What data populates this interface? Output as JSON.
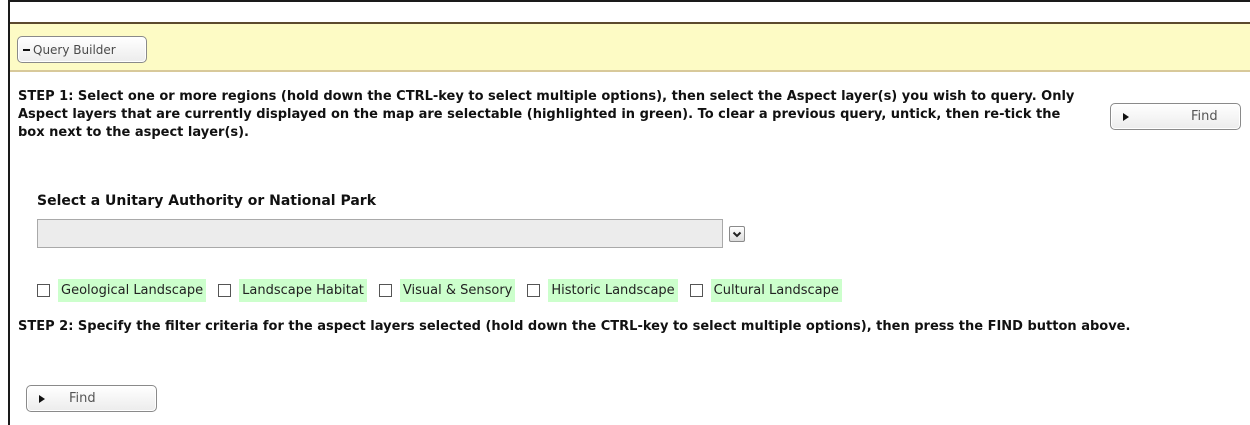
{
  "panel": {
    "toggle_symbol": "−",
    "title": "Query Builder"
  },
  "step1": {
    "text": "STEP 1: Select one or more regions (hold down the CTRL-key to select multiple options), then select the Aspect layer(s) you wish to query. Only Aspect layers that are currently displayed on the map are selectable (highlighted in green). To clear a previous query, untick, then re-tick the box next to the aspect layer(s)."
  },
  "find_button": {
    "label": "Find"
  },
  "region": {
    "label": "Select a Unitary Authority or National Park",
    "selected_value": ""
  },
  "aspect_layers": [
    {
      "label": "Geological Landscape",
      "checked": false
    },
    {
      "label": "Landscape Habitat",
      "checked": false
    },
    {
      "label": "Visual & Sensory",
      "checked": false
    },
    {
      "label": "Historic Landscape",
      "checked": false
    },
    {
      "label": "Cultural Landscape",
      "checked": false
    }
  ],
  "colors": {
    "header_bg": "#fdfbc5",
    "selectable_highlight": "#ccffcc"
  },
  "step2": {
    "text": "STEP 2: Specify the filter criteria for the aspect layers selected (hold down the CTRL-key to select multiple options), then press the FIND button above."
  }
}
